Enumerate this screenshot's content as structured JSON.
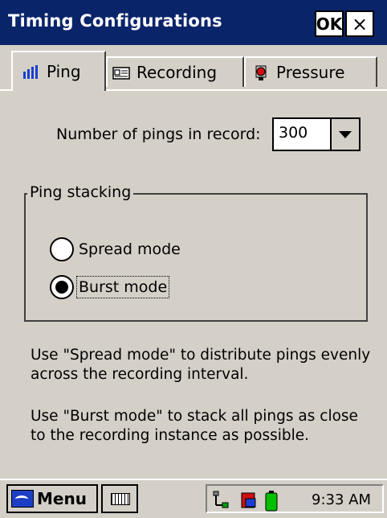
{
  "window": {
    "title": "Timing Configurations",
    "ok_label": "OK",
    "close_label": "×"
  },
  "tabs": [
    {
      "label": "Ping",
      "icon": "signal-bars-icon",
      "active": true
    },
    {
      "label": "Recording",
      "icon": "recording-icon",
      "active": false
    },
    {
      "label": "Pressure",
      "icon": "pressure-icon",
      "active": false
    }
  ],
  "pings": {
    "label": "Number of pings in record:",
    "value": "300"
  },
  "stacking": {
    "title": "Ping stacking",
    "options": [
      {
        "label": "Spread mode",
        "selected": false
      },
      {
        "label": "Burst mode",
        "selected": true
      }
    ]
  },
  "help": {
    "spread": "Use \"Spread mode\" to distribute pings evenly across the recording interval.",
    "burst": "Use \"Burst mode\" to stack all pings as close to the recording instance as possible."
  },
  "taskbar": {
    "menu_label": "Menu",
    "clock": "9:33 AM"
  },
  "colors": {
    "titlebar": "#0a246a",
    "face": "#d4d0c8"
  }
}
